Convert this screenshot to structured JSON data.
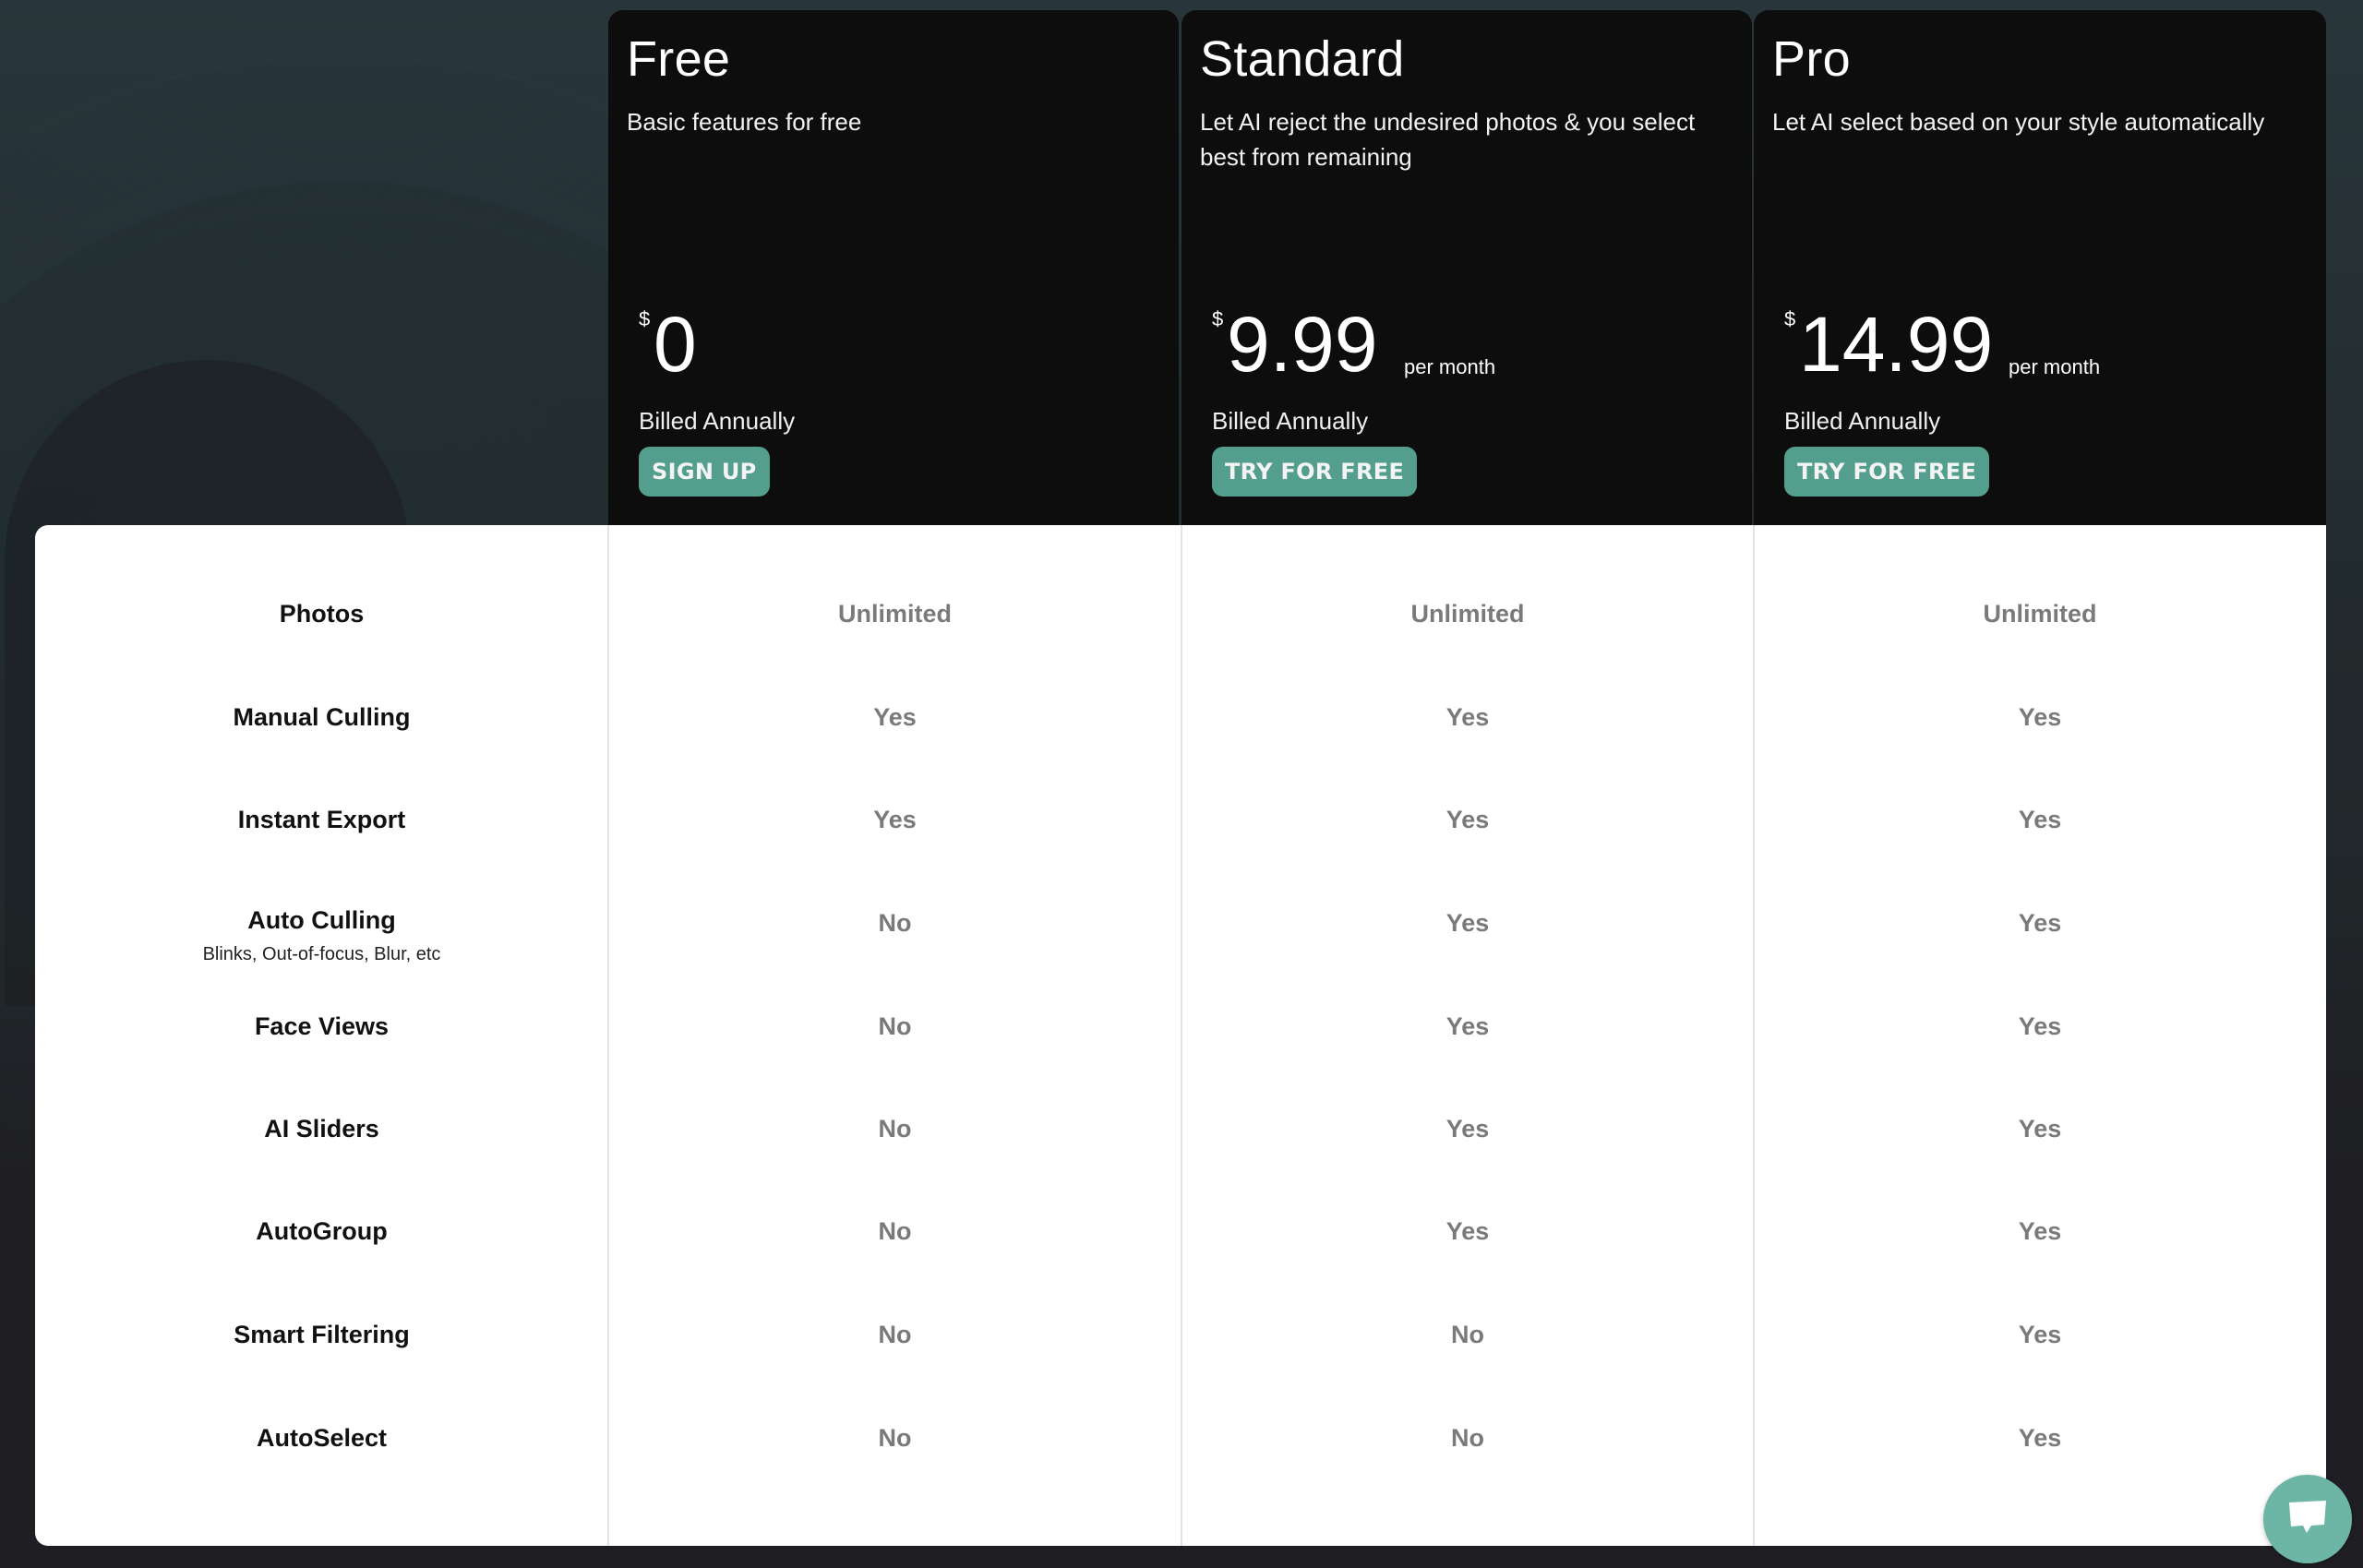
{
  "plans": [
    {
      "name": "Free",
      "description": "Basic features for free",
      "currency": "$",
      "price": "0",
      "period": "",
      "billing": "Billed Annually",
      "cta_label": "SIGN UP"
    },
    {
      "name": "Standard",
      "description": "Let AI reject the undesired photos & you select best from remaining",
      "currency": "$",
      "price": "9.99",
      "period": "per month",
      "billing": "Billed Annually",
      "cta_label": "TRY FOR FREE"
    },
    {
      "name": "Pro",
      "description": "Let AI select based on your style automatically",
      "currency": "$",
      "price": "14.99",
      "period": "per month",
      "billing": "Billed Annually",
      "cta_label": "TRY FOR FREE"
    }
  ],
  "features": [
    {
      "name": "Photos",
      "sub": "",
      "values": [
        "Unlimited",
        "Unlimited",
        "Unlimited"
      ]
    },
    {
      "name": "Manual Culling",
      "sub": "",
      "values": [
        "Yes",
        "Yes",
        "Yes"
      ]
    },
    {
      "name": "Instant Export",
      "sub": "",
      "values": [
        "Yes",
        "Yes",
        "Yes"
      ]
    },
    {
      "name": "Auto Culling",
      "sub": "Blinks, Out-of-focus, Blur, etc",
      "values": [
        "No",
        "Yes",
        "Yes"
      ]
    },
    {
      "name": "Face Views",
      "sub": "",
      "values": [
        "No",
        "Yes",
        "Yes"
      ]
    },
    {
      "name": "AI Sliders",
      "sub": "",
      "values": [
        "No",
        "Yes",
        "Yes"
      ]
    },
    {
      "name": "AutoGroup",
      "sub": "",
      "values": [
        "No",
        "Yes",
        "Yes"
      ]
    },
    {
      "name": "Smart Filtering",
      "sub": "",
      "values": [
        "No",
        "No",
        "Yes"
      ]
    },
    {
      "name": "AutoSelect",
      "sub": "",
      "values": [
        "No",
        "No",
        "Yes"
      ]
    }
  ],
  "chat_widget": {
    "icon": "chat-bubble-icon"
  },
  "colors": {
    "accent": "#549e8d",
    "chat": "#6db5a4",
    "card_bg": "#0d0d0d",
    "value_text": "#7a7a7a"
  }
}
